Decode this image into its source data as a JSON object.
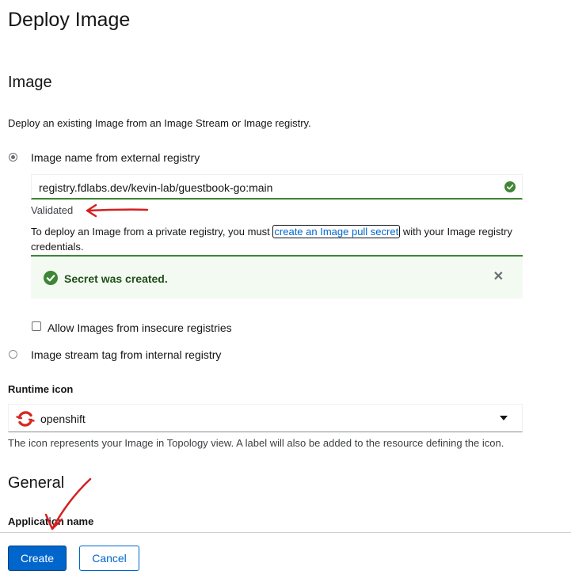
{
  "page": {
    "title": "Deploy Image"
  },
  "image_section": {
    "title": "Image",
    "description": "Deploy an existing Image from an Image Stream or Image registry.",
    "option_external": {
      "label": "Image name from external registry",
      "selected": true
    },
    "image_name_value": "registry.fdlabs.dev/kevin-lab/guestbook-go:main",
    "validation_text": "Validated",
    "pull_secret_text_before": "To deploy an Image from a private registry, you must ",
    "pull_secret_link": "create an Image pull secret",
    "pull_secret_text_after": " with your Image registry credentials.",
    "alert": {
      "title": "Secret was created.",
      "status": "success"
    },
    "insecure_checkbox": {
      "label": "Allow Images from insecure registries",
      "checked": false
    },
    "option_internal": {
      "label": "Image stream tag from internal registry",
      "selected": false
    }
  },
  "runtime_icon": {
    "label": "Runtime icon",
    "selected": "openshift",
    "help": "The icon represents your Image in Topology view. A label will also be added to the resource defining the icon."
  },
  "general_section": {
    "title": "General",
    "application_name_label": "Application name"
  },
  "footer": {
    "create_label": "Create",
    "cancel_label": "Cancel"
  },
  "icons": {
    "validated": "check-circle-icon",
    "alert": "check-circle-icon",
    "alert_close": "close-icon",
    "runtime_logo": "openshift-logo-icon",
    "select_toggle": "caret-down-icon"
  },
  "colors": {
    "success": "#3e8635",
    "primary": "#0066cc",
    "alert_bg": "#f3faf2",
    "annotation": "#d42020"
  }
}
